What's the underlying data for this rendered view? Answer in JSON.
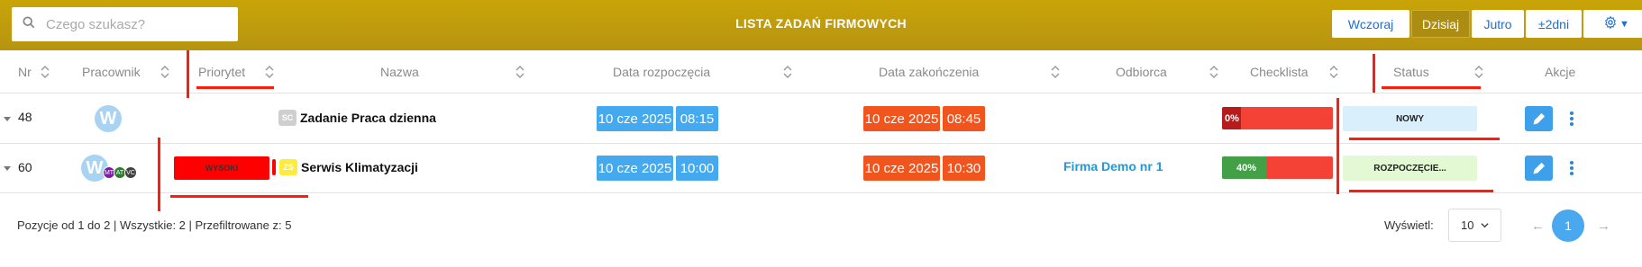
{
  "topbar": {
    "search_placeholder": "Czego szukasz?",
    "title": "LISTA ZADAŃ FIRMOWYCH",
    "date_buttons": [
      "Wczoraj",
      "Dzisiaj",
      "Jutro",
      "±2dni"
    ],
    "active_date_button": "Dzisiaj",
    "settings_caret": "▼"
  },
  "table": {
    "columns": [
      "Nr",
      "Pracownik",
      "Priorytet",
      "Nazwa",
      "Data rozpoczęcia",
      "Data zakończenia",
      "Odbiorca",
      "Checklista",
      "Status",
      "Akcje"
    ],
    "rows": [
      {
        "nr": "48",
        "avatar": "W",
        "sub_avatars": [],
        "priority": "",
        "tag": "SC",
        "tag_color": "#cfcfcf",
        "name": "Zadanie Praca dzienna",
        "start_date": "10 cze 2025",
        "start_time": "08:15",
        "end_date": "10 cze 2025",
        "end_time": "08:45",
        "recipient": "",
        "checklist_label": "0%",
        "checklist_fraction": 0.0,
        "checklist_fill_color": "#b71c1c",
        "status": "NOWY",
        "status_color": "#d9effb"
      },
      {
        "nr": "60",
        "avatar": "W",
        "sub_avatars": [
          {
            "initials": "MT",
            "color": "#7b1fa2"
          },
          {
            "initials": "AT",
            "color": "#2e7d32"
          },
          {
            "initials": "VC",
            "color": "#424242"
          }
        ],
        "priority": "WYSOKI",
        "tag": "ZS",
        "tag_color": "#ffeb3b",
        "name": "Serwis Klimatyzacji",
        "start_date": "10 cze 2025",
        "start_time": "10:00",
        "end_date": "10 cze 2025",
        "end_time": "10:30",
        "recipient": "Firma Demo nr 1",
        "checklist_label": "40%",
        "checklist_fraction": 0.4,
        "checklist_fill_color": "#43a047",
        "status": "ROZPOCZĘCIE...",
        "status_color": "#e3f9d4"
      }
    ]
  },
  "footer": {
    "summary": "Pozycje od 1 do 2 | Wszystkie: 2 | Przefiltrowane z: 5",
    "show_label": "Wyświetl:",
    "per_page": "10",
    "prev": "←",
    "current_page": "1",
    "next": "→"
  },
  "colors": {
    "topbar": "#c2a00c",
    "active_button": "#ad8c12",
    "accent_blue": "#45a9ef",
    "accent_orange": "#f2541e",
    "annotation_red": "#ff1c0a"
  }
}
